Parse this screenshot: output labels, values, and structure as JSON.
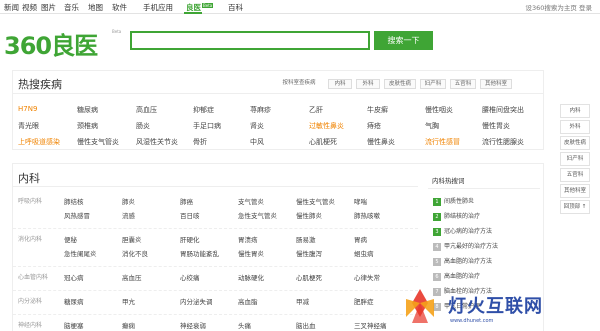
{
  "topnav": {
    "items": [
      "新闻",
      "视频",
      "图片",
      "音乐",
      "地图",
      "软件",
      "手机应用",
      "良医",
      "百科"
    ],
    "beta": "Beta",
    "right": "设360搜索为主页  登录"
  },
  "logo": {
    "text": "360良医",
    "beta": "Beta"
  },
  "search": {
    "value": "",
    "button": "搜索一下"
  },
  "hot": {
    "title": "热搜疾病",
    "tabs": [
      "按科室查疾病",
      "内科",
      "外科",
      "皮肤性病",
      "妇产科",
      "五官科",
      "其他科室"
    ],
    "rows": [
      [
        "H7N9",
        "糖尿病",
        "高血压",
        "抑郁症",
        "荨麻疹",
        "乙肝",
        "牛皮癣",
        "慢性咽炎",
        "腰椎间盘突出"
      ],
      [
        "青光眼",
        "颈椎病",
        "肠炎",
        "手足口病",
        "肾炎",
        "过敏性鼻炎",
        "痔疮",
        "气胸",
        "慢性胃炎"
      ],
      [
        "上呼吸道感染",
        "慢性支气管炎",
        "风湿性关节炎",
        "骨折",
        "中风",
        "心肌梗死",
        "慢性鼻炎",
        "流行性感冒",
        "流行性腮腺炎"
      ]
    ],
    "orange_keys": [
      "H7N9",
      "过敏性鼻炎",
      "上呼吸道感染",
      "流行性感冒"
    ]
  },
  "side": [
    "内科",
    "外科",
    "皮肤性病",
    "妇产科",
    "五官科",
    "其他科室",
    "回顶部 ↑"
  ],
  "internal": {
    "title": "内科",
    "categories": [
      {
        "name": "呼吸内科",
        "rows": [
          [
            "肺结核",
            "肺炎",
            "肺癌",
            "支气管炎",
            "慢性支气管炎",
            "哮喘"
          ],
          [
            "风热感冒",
            "流感",
            "百日咳",
            "急性支气管炎",
            "慢性肺炎",
            "肺热咳嗽"
          ]
        ]
      },
      {
        "name": "消化内科",
        "rows": [
          [
            "便秘",
            "胆囊炎",
            "肝硬化",
            "胃溃疡",
            "肠易激",
            "胃病"
          ],
          [
            "急性阑尾炎",
            "消化不良",
            "胃肠功能紊乱",
            "慢性胃炎",
            "慢性腹泻",
            "蛔虫病"
          ]
        ]
      },
      {
        "name": "心血管内科",
        "rows": [
          [
            "冠心病",
            "高血压",
            "心绞痛",
            "动脉硬化",
            "心肌梗死",
            "心律失常"
          ]
        ]
      },
      {
        "name": "内分泌科",
        "rows": [
          [
            "糖尿病",
            "甲亢",
            "内分泌失调",
            "高血脂",
            "甲减",
            "肥胖症"
          ]
        ]
      },
      {
        "name": "神经内科",
        "rows": [
          [
            "脑梗塞",
            "癫痫",
            "神经衰弱",
            "头痛",
            "脑出血",
            "三叉神经痛"
          ]
        ]
      }
    ]
  },
  "query": {
    "title": "内科热搜词",
    "items": [
      "间质性肺炎",
      "肺结核的治疗",
      "冠心病的治疗方法",
      "甲亢最好的治疗方法",
      "高血脂的治疗方法",
      "高血脂的治疗",
      "脑血栓的治疗方法",
      "甲亢日常护理"
    ]
  },
  "watermark": {
    "text": "灯火互联网",
    "sub": "www.dhunet.com"
  },
  "colors": {
    "accent": "#3fa535",
    "orange": "#f08300"
  }
}
